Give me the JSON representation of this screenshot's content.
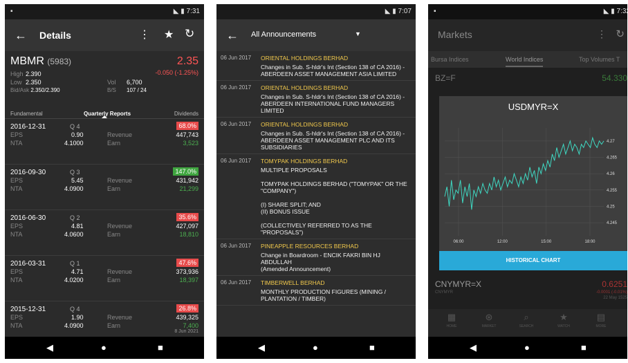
{
  "screen1": {
    "status_time": "7:31",
    "title": "Details",
    "code": "MBMR",
    "code_num": "(5983)",
    "price": "2.35",
    "change": "-0.050 (-1.25%)",
    "high_label": "High",
    "high": "2.390",
    "low_label": "Low",
    "low": "2.350",
    "vol_label": "Vol",
    "vol": "6,700",
    "bidask_label": "Bid/Ask",
    "bidask": "2.350/2.390",
    "bs_label": "B/S",
    "bs": "107 / 24",
    "tabs": [
      "Fundamental",
      "Quarterly Reports",
      "Dividends"
    ],
    "reports": [
      {
        "date": "2016-12-31",
        "q": "Q 4",
        "pct": "68.0%",
        "pct_color": "#e84b4b",
        "eps": "0.90",
        "revenue": "447,743",
        "nta": "4.1000",
        "earn": "3,523"
      },
      {
        "date": "2016-09-30",
        "q": "Q 3",
        "pct": "147.0%",
        "pct_color": "#3fa53f",
        "eps": "5.45",
        "revenue": "431,942",
        "nta": "4.0900",
        "earn": "21,299"
      },
      {
        "date": "2016-06-30",
        "q": "Q 2",
        "pct": "35.6%",
        "pct_color": "#e84b4b",
        "eps": "4.81",
        "revenue": "427,097",
        "nta": "4.0600",
        "earn": "18,810"
      },
      {
        "date": "2016-03-31",
        "q": "Q 1",
        "pct": "47.6%",
        "pct_color": "#e84b4b",
        "eps": "4.71",
        "revenue": "373,936",
        "nta": "4.0200",
        "earn": "18,397"
      },
      {
        "date": "2015-12-31",
        "q": "Q 4",
        "pct": "26.8%",
        "pct_color": "#e84b4b",
        "eps": "1.90",
        "revenue": "439,325",
        "nta": "4.0900",
        "earn": "7,400"
      }
    ],
    "labels": {
      "eps": "EPS",
      "nta": "NTA",
      "revenue": "Revenue",
      "earn": "Earn"
    },
    "foot_date": "8 Jun 2021"
  },
  "screen2": {
    "status_time": "7:07",
    "title": "All Announcements",
    "items": [
      {
        "date": "06 Jun 2017",
        "company": "ORIENTAL HOLDINGS BERHAD",
        "body": "Changes in Sub. S-hldr's Int (Section 138 of CA 2016) - ABERDEEN ASSET MANAGEMENT ASIA LIMITED"
      },
      {
        "date": "06 Jun 2017",
        "company": "ORIENTAL HOLDINGS BERHAD",
        "body": "Changes in Sub. S-hldr's Int (Section 138 of CA 2016) - ABERDEEN INTERNATIONAL FUND MANAGERS LIMITED"
      },
      {
        "date": "06 Jun 2017",
        "company": "ORIENTAL HOLDINGS BERHAD",
        "body": "Changes in Sub. S-hldr's Int (Section 138 of CA 2016) - ABERDEEN ASSET MANAGEMENT PLC AND ITS SUBSIDIARIES"
      },
      {
        "date": "06 Jun 2017",
        "company": "TOMYPAK HOLDINGS BERHAD",
        "body": "MULTIPLE PROPOSALS\n\n      TOMYPAK HOLDINGS BERHAD (\"TOMYPAK\" OR THE \"COMPANY\")\n\n(I) SHARE SPLIT; AND\n(II) BONUS ISSUE\n\n(COLLECTIVELY REFERRED TO AS THE \"PROPOSALS\")"
      },
      {
        "date": "06 Jun 2017",
        "company": "PINEAPPLE RESOURCES BERHAD",
        "body": "Change in Boardroom - ENCIK FAKRI BIN HJ ABDULLAH\n      (Amended Announcement)"
      },
      {
        "date": "06 Jun 2017",
        "company": "TIMBERWELL BERHAD",
        "body": "MONTHLY PRODUCTION FIGURES (MINING / PLANTATION / TIMBER)"
      }
    ]
  },
  "screen3": {
    "status_time": "7:32",
    "title": "Markets",
    "tabs": [
      "Bursa Indices",
      "World Indices",
      "Top Volumes T"
    ],
    "row1": "BZ=F",
    "row1_val": "54.330",
    "row2": "CNYMYR=X",
    "row2_val": "0.6251",
    "row2_sub": "CNYMYR",
    "row2_meta1": "-0.0001 (-0.01%)",
    "row2_meta2": "22 May 1525",
    "dialog_title": "USDMYR=X",
    "dialog_button": "HISTORICAL CHART",
    "bottom_nav": [
      "HOME",
      "MARKET",
      "SEARCH",
      "WATCH",
      "MORE"
    ],
    "chart_data": {
      "type": "line",
      "x_ticks": [
        "06:00",
        "12:00",
        "15:00",
        "18:00"
      ],
      "y_ticks": [
        "4.27",
        "4.265",
        "4.26",
        "4.255",
        "4.25",
        "4.245"
      ],
      "ylim": [
        4.241,
        4.274
      ],
      "color": "#3fd9c3",
      "values": [
        4.253,
        4.256,
        4.25,
        4.258,
        4.252,
        4.255,
        4.254,
        4.258,
        4.251,
        4.256,
        4.253,
        4.257,
        4.249,
        4.255,
        4.253,
        4.256,
        4.254,
        4.257,
        4.255,
        4.254,
        4.257,
        4.255,
        4.259,
        4.256,
        4.258,
        4.255,
        4.257,
        4.259,
        4.256,
        4.258,
        4.257,
        4.26,
        4.258,
        4.256,
        4.259,
        4.257,
        4.26,
        4.258,
        4.262,
        4.259,
        4.261,
        4.257,
        4.262,
        4.26,
        4.263,
        4.261,
        4.264,
        4.262,
        4.266,
        4.264,
        4.268,
        4.265,
        4.267,
        4.269,
        4.266,
        4.268,
        4.27,
        4.267,
        4.269,
        4.268,
        4.266,
        4.269,
        4.268,
        4.27,
        4.269,
        4.268,
        4.271,
        4.269,
        4.268,
        4.27,
        4.269,
        4.27
      ]
    }
  }
}
